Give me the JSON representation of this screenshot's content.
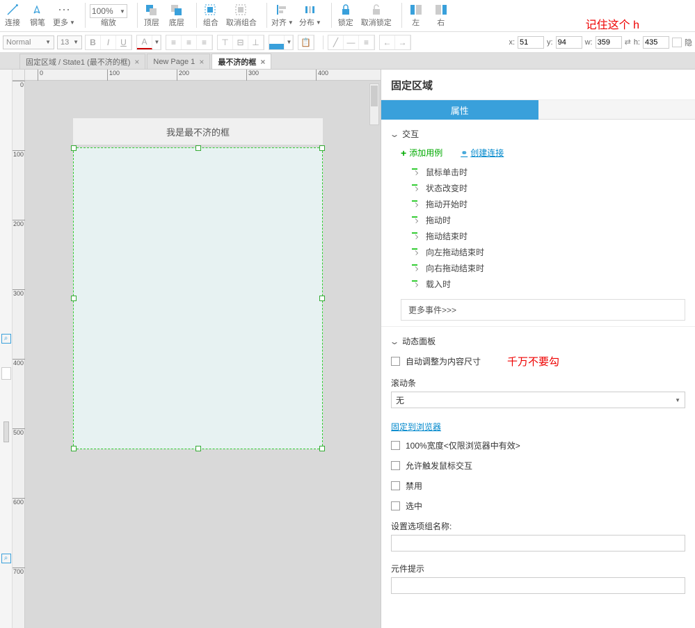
{
  "toolbar": {
    "connect": "连接",
    "pen": "钢笔",
    "more": "更多",
    "zoom_value": "100%",
    "zoom_label": "缩放",
    "front": "顶层",
    "back": "底层",
    "group": "组合",
    "ungroup": "取消组合",
    "align": "对齐",
    "distribute": "分布",
    "lock": "锁定",
    "unlock": "取消锁定",
    "left": "左",
    "right": "右"
  },
  "annotation1": "记住这个 h",
  "format": {
    "style": "Normal",
    "font_size": "13",
    "x_label": "x:",
    "x": "51",
    "y_label": "y:",
    "y": "94",
    "w_label": "w:",
    "w": "359",
    "h_label": "h:",
    "h": "435",
    "hidden_label": "隐"
  },
  "tabs": [
    {
      "label": "固定区域 / State1 (最不济的框)",
      "active": false
    },
    {
      "label": "New Page 1",
      "active": false
    },
    {
      "label": "最不济的框",
      "active": true
    }
  ],
  "ruler_h": [
    "0",
    "100",
    "200",
    "300",
    "400"
  ],
  "ruler_v": [
    "0",
    "100",
    "200",
    "300",
    "400",
    "500",
    "600",
    "700"
  ],
  "canvas": {
    "header_text": "我是最不济的框"
  },
  "panel": {
    "title": "固定区域",
    "tab_properties": "属性",
    "section_interactions": "交互",
    "add_case": "添加用例",
    "create_link": "创建连接",
    "events": [
      "鼠标单击时",
      "状态改变时",
      "拖动开始时",
      "拖动时",
      "拖动结束时",
      "向左拖动结束时",
      "向右拖动结束时",
      "载入时"
    ],
    "more_events": "更多事件>>>",
    "section_dynamic": "动态面板",
    "fit_content": "自动调整为内容尺寸",
    "annotation2": "千万不要勾",
    "scrollbar_label": "滚动条",
    "scrollbar_value": "无",
    "pin_browser": "固定到浏览器",
    "width_100": "100%宽度<仅限浏览器中有效>",
    "allow_mouse": "允许触发鼠标交互",
    "disabled": "禁用",
    "selected": "选中",
    "option_group_label": "设置选项组名称:",
    "tooltip_label": "元件提示"
  }
}
